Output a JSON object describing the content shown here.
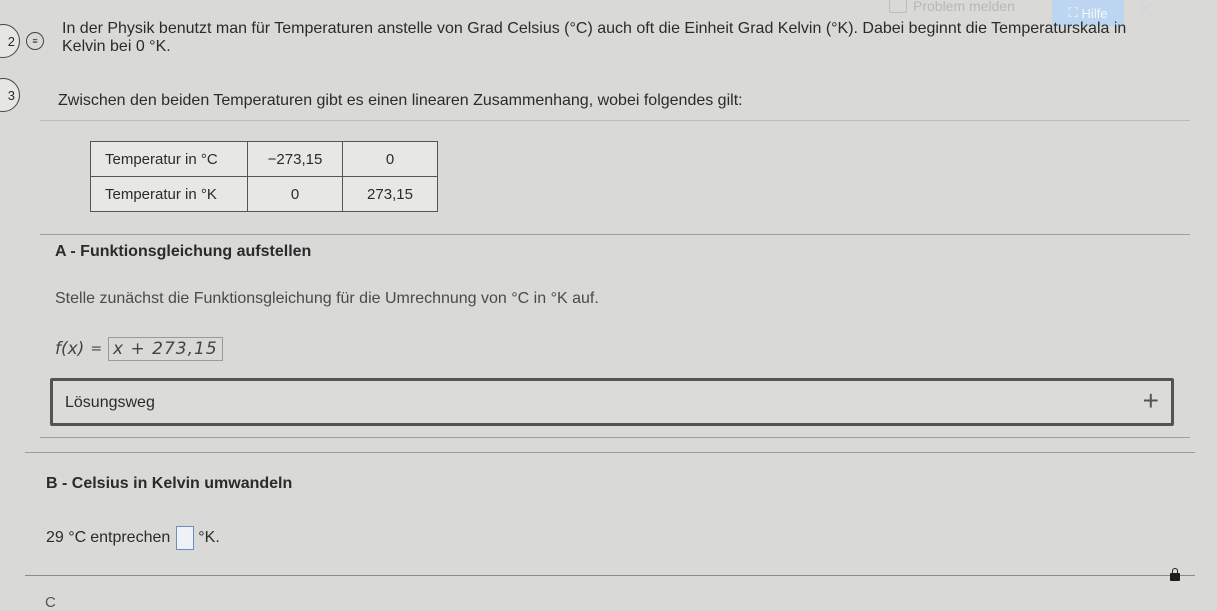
{
  "topbar": {
    "report_label": "Problem melden",
    "help_label": "Hilfe"
  },
  "steps": [
    "2",
    "3"
  ],
  "intro": {
    "text": "In der Physik benutzt man für Temperaturen anstelle von Grad Celsius (°C) auch oft die Einheit Grad Kelvin (°K). Dabei beginnt die Temperaturskala in",
    "text2": "Kelvin bei 0 °K."
  },
  "subtitle": "Zwischen den beiden Temperaturen gibt es einen linearen Zusammenhang, wobei folgendes gilt:",
  "table": {
    "rows": [
      [
        "Temperatur in °C",
        "−273,15",
        "0"
      ],
      [
        "Temperatur in °K",
        "0",
        "273,15"
      ]
    ]
  },
  "section_a": {
    "title": "A - Funktionsgleichung aufstellen",
    "instruction": "Stelle zunächst die Funktionsgleichung für die Umrechnung von °C in °K auf.",
    "formula_lhs": "f(x)",
    "formula_eq": "=",
    "answer": "x + 273,15"
  },
  "solution": {
    "label": "Lösungsweg",
    "toggle": "+"
  },
  "section_b": {
    "title": "B - Celsius in Kelvin umwandeln",
    "value": "29 °C",
    "verb": "entprechen",
    "unit": "°K."
  },
  "section_c": {
    "label": "C"
  }
}
